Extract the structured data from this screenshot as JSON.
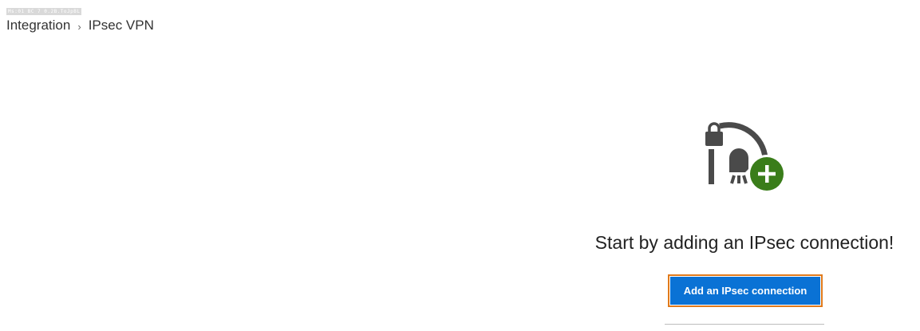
{
  "window": {
    "tiny_label": "Ms:01 BC 7 0.2B.ToJpBL"
  },
  "breadcrumb": {
    "items": [
      {
        "label": "Integration"
      },
      {
        "label": "IPsec VPN"
      }
    ],
    "separator": "›"
  },
  "empty_state": {
    "icon": "vpn-lock-plus-icon",
    "title": "Start by adding an IPsec connection!",
    "button_label": "Add an IPsec connection"
  },
  "colors": {
    "accent": "#0a72d5",
    "focus_ring": "#e07a1c",
    "icon_gray": "#4a4a4a",
    "plus_green": "#3a7d1a"
  }
}
